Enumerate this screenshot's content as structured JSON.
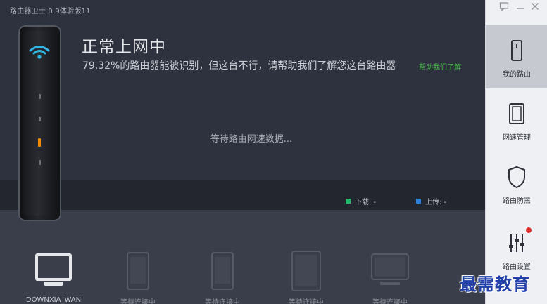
{
  "app": {
    "title": "路由器卫士 0.9体验版11"
  },
  "status": {
    "title": "正常上网中",
    "description": "79.32%的路由器能被识别，但这台不行，请帮助我们了解您这台路由器",
    "help_link": "帮助我们了解",
    "waiting": "等待路由网速数据..."
  },
  "legend": {
    "download": {
      "label": "下载: -",
      "color": "#2bb56a"
    },
    "upload": {
      "label": "上传: -",
      "color": "#2d7fd6"
    }
  },
  "devices": [
    {
      "label": "DOWNXIA_WAN",
      "icon": "computer-icon",
      "connected": true
    },
    {
      "label": "等待连接中",
      "icon": "phone-icon",
      "connected": false
    },
    {
      "label": "等待连接中",
      "icon": "phone-icon",
      "connected": false
    },
    {
      "label": "等待连接中",
      "icon": "tablet-icon",
      "connected": false
    },
    {
      "label": "等待连接中",
      "icon": "laptop-icon",
      "connected": false
    }
  ],
  "sidebar": {
    "items": [
      {
        "label": "我的路由",
        "icon": "phone-outline-icon",
        "active": true
      },
      {
        "label": "网速管理",
        "icon": "tablet-outline-icon",
        "active": false
      },
      {
        "label": "路由防黑",
        "icon": "shield-icon",
        "active": false
      },
      {
        "label": "路由设置",
        "icon": "sliders-icon",
        "active": false,
        "badge": true
      }
    ]
  },
  "watermark": "最需教育",
  "colors": {
    "accent_green": "#49b94a",
    "led_orange": "#f08a00",
    "badge_red": "#e0322e"
  }
}
